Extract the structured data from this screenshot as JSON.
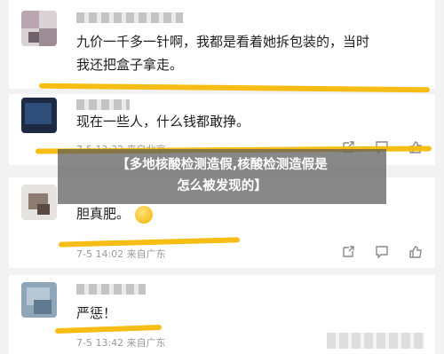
{
  "comments": [
    {
      "text_line1": "九价一千多一针啊，我都是看着她拆包装的，当时",
      "text_line2": "我还把盒子拿走。"
    },
    {
      "text": "现在一些人，什么钱都敢挣。",
      "meta": "7-5 13:32 来自北京"
    },
    {
      "text": "胆真肥。",
      "meta": "7-5 14:02 来自广东"
    },
    {
      "text": "严惩！",
      "meta": "7-5 13:42 来自广东"
    }
  ],
  "overlay": {
    "line1": "【多地核酸检测造假,核酸检测造假是",
    "line2": "怎么被发现的】"
  },
  "icons": [
    "share-icon",
    "comment-icon",
    "like-icon"
  ],
  "colors": {
    "highlight": "#f5b800",
    "background": "#f2f2f2"
  }
}
